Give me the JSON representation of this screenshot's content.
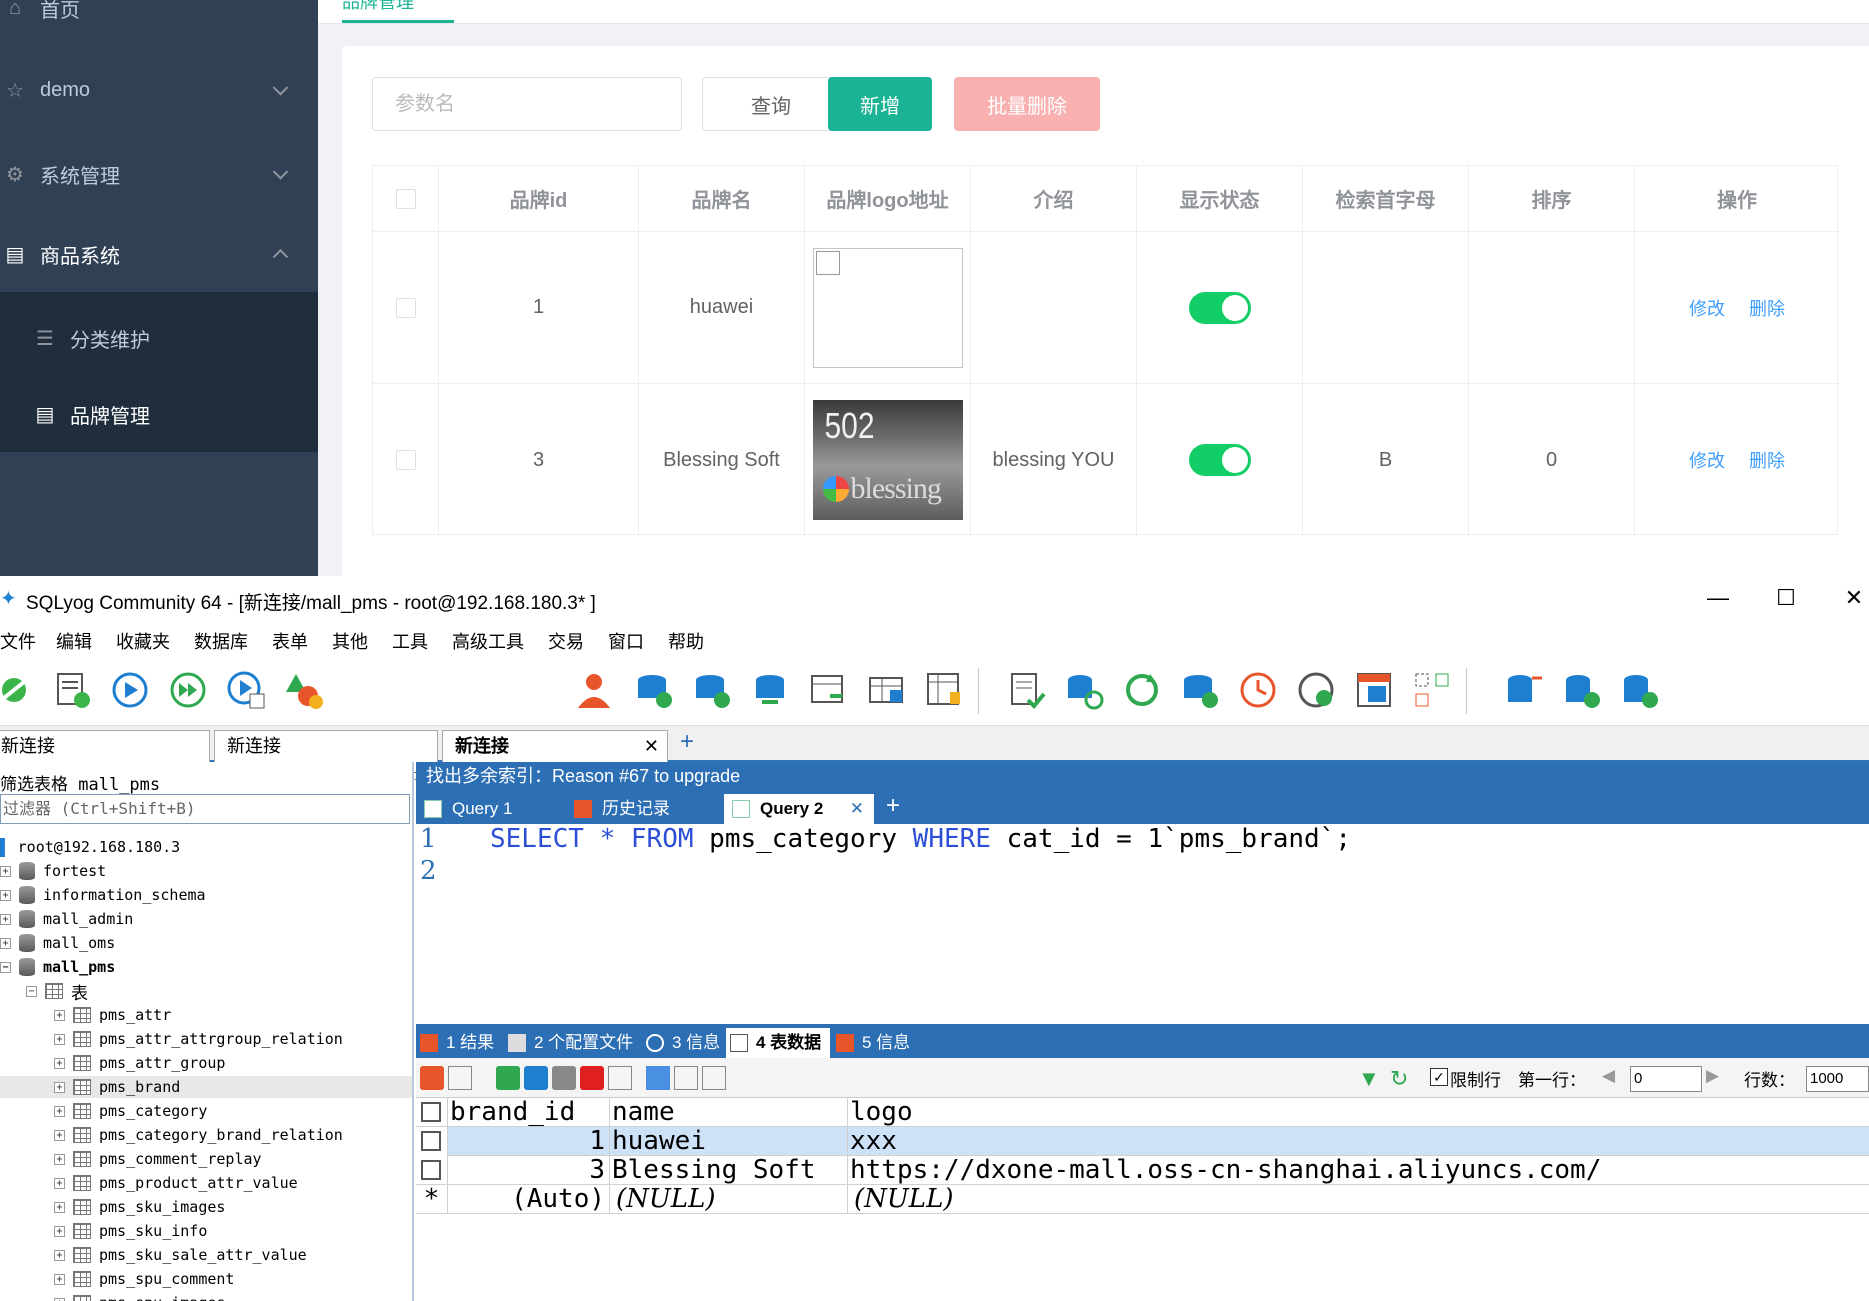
{
  "web": {
    "sidebar": {
      "items": [
        {
          "label": "首页",
          "icon": "home-icon"
        },
        {
          "label": "demo",
          "icon": "star-icon"
        },
        {
          "label": "系统管理",
          "icon": "gear-icon"
        },
        {
          "label": "商品系统",
          "icon": "list-icon"
        }
      ],
      "subitems": [
        {
          "label": "分类维护",
          "icon": "menu-lines-icon"
        },
        {
          "label": "品牌管理",
          "icon": "doc-list-icon"
        }
      ]
    },
    "tab": {
      "label": "品牌管理"
    },
    "search": {
      "placeholder": "参数名"
    },
    "buttons": {
      "query": "查询",
      "add": "新增",
      "batch_delete": "批量删除"
    },
    "table": {
      "headers": [
        "品牌id",
        "品牌名",
        "品牌logo地址",
        "介绍",
        "显示状态",
        "检索首字母",
        "排序",
        "操作"
      ],
      "rows": [
        {
          "id": "1",
          "name": "huawei",
          "logo": "broken",
          "intro": "",
          "status": true,
          "first_letter": "",
          "sort": ""
        },
        {
          "id": "3",
          "name": "Blessing Soft",
          "logo": "image",
          "intro": "blessing YOU",
          "status": true,
          "first_letter": "B",
          "sort": "0"
        }
      ],
      "edit_label": "修改",
      "delete_label": "删除",
      "logo_text_num": "502",
      "logo_text_word": "blessing"
    },
    "colors": {
      "accent": "#1ab394",
      "danger_light": "#f8b0b0",
      "sidebar": "#304156",
      "link": "#409eff",
      "switch_on": "#13ce66"
    }
  },
  "sqlyog": {
    "title": "SQLyog Community 64 - [新连接/mall_pms - root@192.168.180.3* ]",
    "menus": [
      "文件",
      "编辑",
      "收藏夹",
      "数据库",
      "表单",
      "其他",
      "工具",
      "高级工具",
      "交易",
      "窗口",
      "帮助"
    ],
    "db_select": "mall_pms",
    "conn_tabs": [
      "新连接",
      "新连接",
      "新连接"
    ],
    "filter_label": "筛选表格 mall_pms",
    "filter_placeholder": "过滤器 (Ctrl+Shift+B)",
    "tree": {
      "root": "root@192.168.180.3",
      "dbs": [
        "fortest",
        "information_schema",
        "mall_admin",
        "mall_oms",
        "mall_pms"
      ],
      "tables_label": "表",
      "tables": [
        "pms_attr",
        "pms_attr_attrgroup_relation",
        "pms_attr_group",
        "pms_brand",
        "pms_category",
        "pms_category_brand_relation",
        "pms_comment_replay",
        "pms_product_attr_value",
        "pms_sku_images",
        "pms_sku_info",
        "pms_sku_sale_attr_value",
        "pms_spu_comment",
        "pms_spu_images"
      ]
    },
    "hint": "找出多余索引：Reason #67 to upgrade",
    "query_tabs": [
      "Query 1",
      "历史记录",
      "Query 2"
    ],
    "code": {
      "line1_no": "1",
      "line2_no": "2",
      "kw_select": "SELECT",
      "star": "*",
      "kw_from": "FROM",
      "table": "pms_category",
      "kw_where": "WHERE",
      "rest": "cat_id = 1`pms_brand`;"
    },
    "result_tabs": [
      "1 结果",
      "2 个配置文件",
      "3 信息",
      "4 表数据",
      "5 信息"
    ],
    "result_toolbar": {
      "limit_label": "限制行",
      "first_row_label": "第一行：",
      "first_row_value": "0",
      "rows_label": "行数：",
      "rows_value": "1000"
    },
    "result": {
      "columns": [
        "brand_id",
        "name",
        "logo"
      ],
      "rows": [
        [
          "1",
          "huawei",
          "xxx"
        ],
        [
          "3",
          "Blessing Soft",
          "https://dxone-mall.oss-cn-shanghai.aliyuncs.com/"
        ],
        [
          "(Auto)",
          "(NULL)",
          "(NULL)"
        ]
      ],
      "new_row_marker": "*"
    },
    "colors": {
      "blue_bar": "#2d6fb5",
      "keyword": "#2d4fd8",
      "row_highlight": "#cde1f7"
    }
  }
}
